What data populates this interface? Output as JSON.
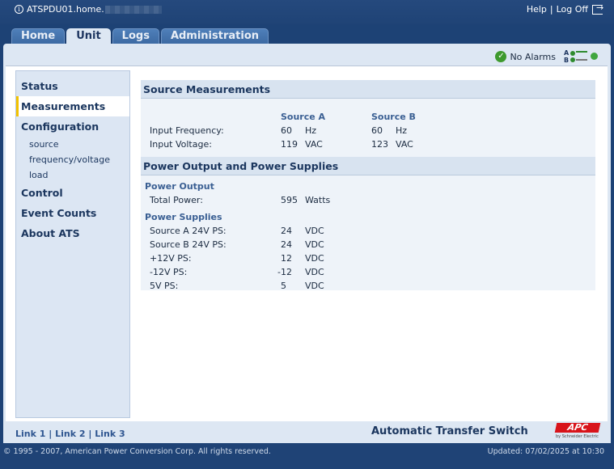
{
  "topbar": {
    "host": "ATSPDU01.home.",
    "help": "Help",
    "separator": "|",
    "logoff": "Log Off"
  },
  "tabs": [
    "Home",
    "Unit",
    "Logs",
    "Administration"
  ],
  "active_tab": "Unit",
  "alarm": {
    "text": "No Alarms",
    "a_label": "A",
    "b_label": "B"
  },
  "nav": {
    "status": "Status",
    "measurements": "Measurements",
    "configuration": "Configuration",
    "config_items": [
      "source",
      "frequency/voltage",
      "load"
    ],
    "control": "Control",
    "event_counts": "Event Counts",
    "about": "About ATS"
  },
  "source_measurements": {
    "title": "Source Measurements",
    "col_a": "Source A",
    "col_b": "Source B",
    "rows": [
      {
        "label": "Input Frequency:",
        "a_val": "60",
        "a_unit": "Hz",
        "b_val": "60",
        "b_unit": "Hz"
      },
      {
        "label": "Input Voltage:",
        "a_val": "119",
        "a_unit": "VAC",
        "b_val": "123",
        "b_unit": "VAC"
      }
    ]
  },
  "power": {
    "title": "Power Output and Power Supplies",
    "output_head": "Power Output",
    "total_label": "Total Power:",
    "total_val": "595",
    "total_unit": "Watts",
    "supplies_head": "Power Supplies",
    "supplies": [
      {
        "label": "Source A 24V PS:",
        "val": "24",
        "unit": "VDC"
      },
      {
        "label": "Source B 24V PS:",
        "val": "24",
        "unit": "VDC"
      },
      {
        "label": "+12V PS:",
        "val": "12",
        "unit": "VDC"
      },
      {
        "label": "-12V PS:",
        "val": "-12",
        "unit": "VDC"
      },
      {
        "label": "5V PS:",
        "val": "5",
        "unit": "VDC"
      }
    ]
  },
  "footer": {
    "links": [
      "Link 1",
      "Link 2",
      "Link 3"
    ],
    "link_sep": "|",
    "product": "Automatic Transfer Switch",
    "logo_text": "APC",
    "logo_sub": "by Schneider Electric",
    "copyright": "© 1995 - 2007, American Power Conversion Corp. All rights reserved.",
    "updated": "Updated: 07/02/2025 at 10:30"
  }
}
